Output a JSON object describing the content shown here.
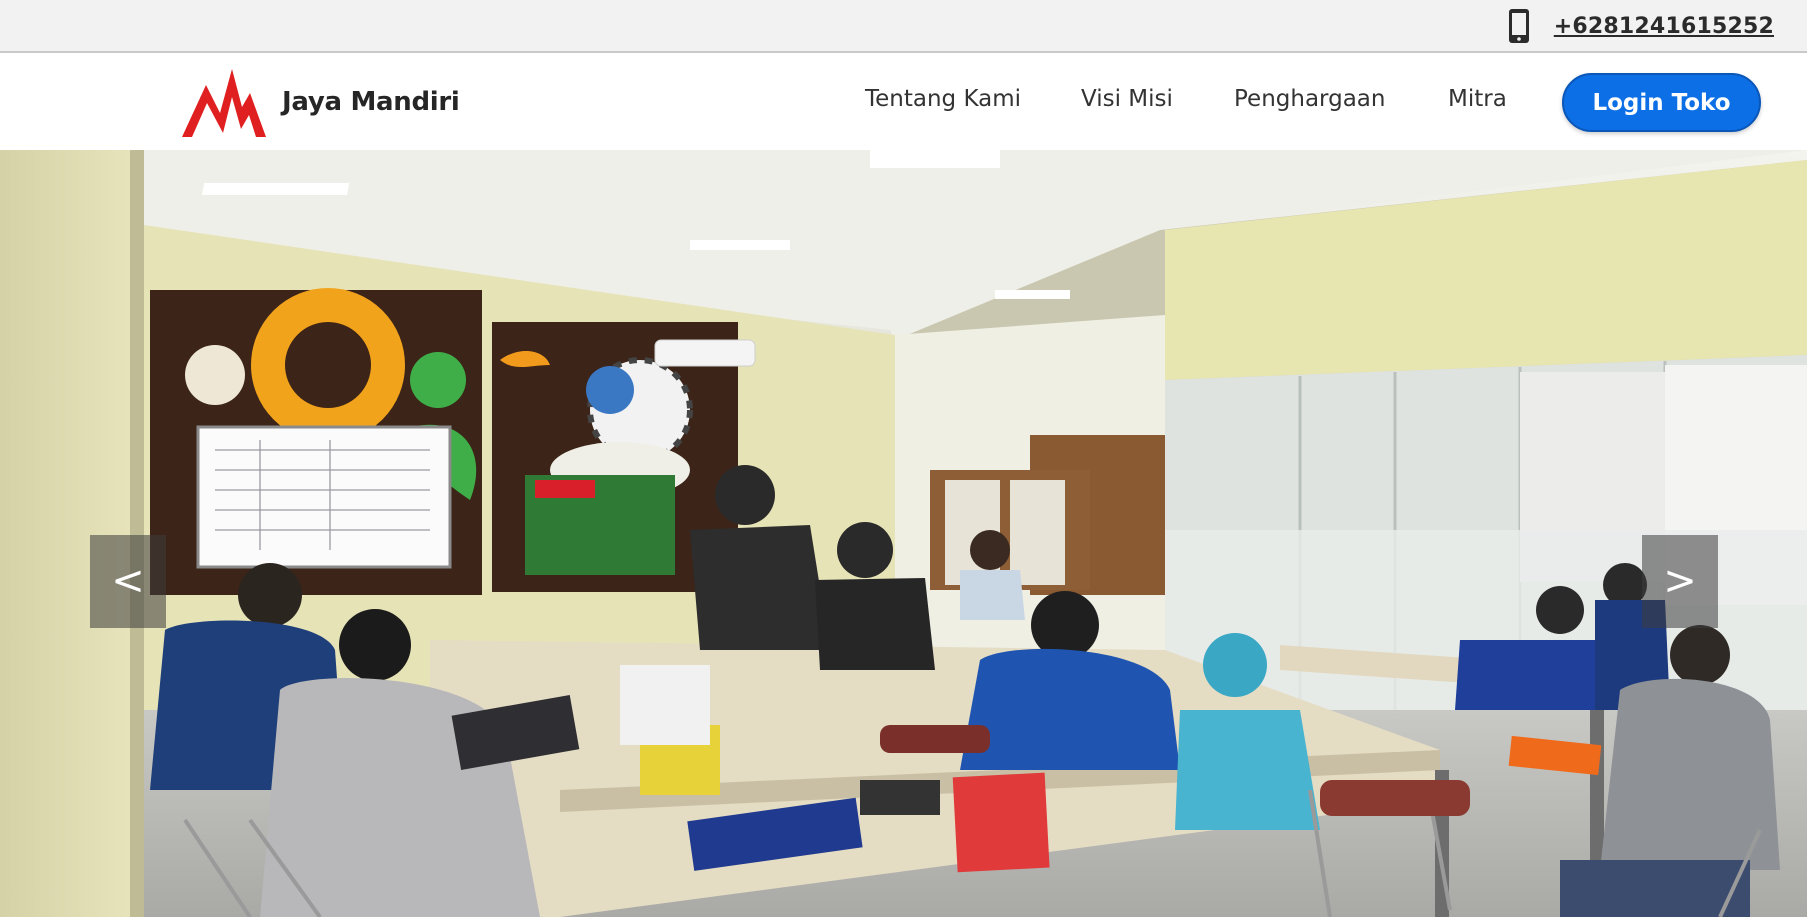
{
  "topbar": {
    "phone_icon": "mobile-phone-icon",
    "phone_number": "+6281241615252"
  },
  "brand": {
    "logo_icon": "jaya-mandiri-logo",
    "name": "Jaya Mandiri",
    "logo_color": "#e02020"
  },
  "nav": {
    "items": [
      {
        "label": "Tentang Kami"
      },
      {
        "label": "Visi Misi"
      },
      {
        "label": "Penghargaan"
      },
      {
        "label": "Mitra"
      }
    ],
    "login_label": "Login Toko",
    "login_color": "#0d6fe6"
  },
  "carousel": {
    "prev_label": "<",
    "next_label": ">"
  }
}
